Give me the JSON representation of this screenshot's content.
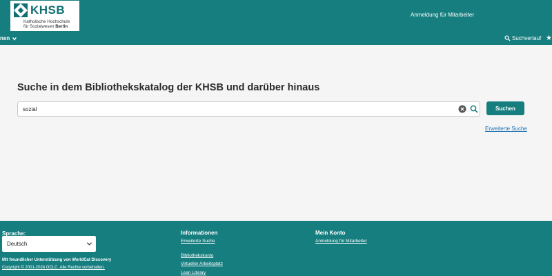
{
  "header": {
    "logo": {
      "title": "KHSB",
      "line1": "Katholische Hochschule",
      "line2_prefix": "für Sozialwesen ",
      "line2_bold": "Berlin"
    },
    "staff_login": "Anmeldung für Mitarbeiter",
    "nav_left": "nen",
    "search_history": "Suchverlauf",
    "star_icon": "star-icon",
    "brand_color": "#177e80"
  },
  "main": {
    "title": "Suche in dem Bibliothekskatalog der KHSB und darüber hinaus",
    "search": {
      "value": "sozial",
      "placeholder": ""
    },
    "search_button": "Suchen",
    "advanced_link": "Erweiterte Suche"
  },
  "footer": {
    "language_label": "Sprache:",
    "language_value": "Deutsch",
    "support_text": "Mit freundlicher Unterstützung von WorldCat Discovery",
    "copyright": "Copyright © 2001-2024 OCLC. Alle Rechte vorbehalten.",
    "info": {
      "heading": "Informationen",
      "links": [
        "Erweiterte Suche",
        "Bibliothekskonto",
        "Virtueller Arbeitsplatz",
        "Lean Library"
      ]
    },
    "account": {
      "heading": "Mein Konto",
      "links": [
        "Anmeldung für Mitarbeiter"
      ]
    }
  }
}
